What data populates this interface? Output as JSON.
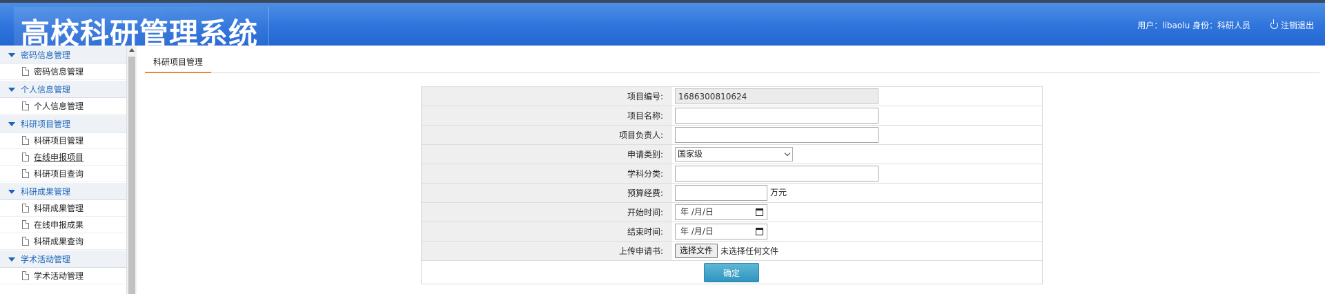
{
  "header": {
    "title": "高校科研管理系统",
    "user_info": "用户：libaolu 身份：科研人员",
    "logout_label": "注销退出"
  },
  "sidebar": {
    "groups": [
      {
        "title": "密码信息管理",
        "items": [
          "密码信息管理"
        ]
      },
      {
        "title": "个人信息管理",
        "items": [
          "个人信息管理"
        ]
      },
      {
        "title": "科研项目管理",
        "items": [
          "科研项目管理",
          "在线申报项目",
          "科研项目查询"
        ]
      },
      {
        "title": "科研成果管理",
        "items": [
          "科研成果管理",
          "在线申报成果",
          "科研成果查询"
        ]
      },
      {
        "title": "学术活动管理",
        "items": [
          "学术活动管理"
        ]
      }
    ]
  },
  "main": {
    "tab_label": "科研项目管理"
  },
  "form": {
    "project_no_label": "项目编号:",
    "project_no_value": "1686300810624",
    "project_name_label": "项目名称:",
    "project_name_value": "",
    "leader_label": "项目负责人:",
    "leader_value": "",
    "category_label": "申请类别:",
    "category_value": "国家级",
    "subject_label": "学科分类:",
    "subject_value": "",
    "budget_label": "预算经费:",
    "budget_value": "",
    "budget_unit": "万元",
    "start_label": "开始时间:",
    "start_placeholder": "年 /月/日",
    "end_label": "结束时间:",
    "end_placeholder": "年 /月/日",
    "upload_label": "上传申请书:",
    "upload_button": "选择文件",
    "upload_status": "未选择任何文件",
    "submit_label": "确定"
  },
  "colors": {
    "header_blue": "#2f74dc",
    "menu_title_blue": "#1b64b7",
    "tab_underline": "#e8863a",
    "submit_button": "#3a9ec6"
  }
}
